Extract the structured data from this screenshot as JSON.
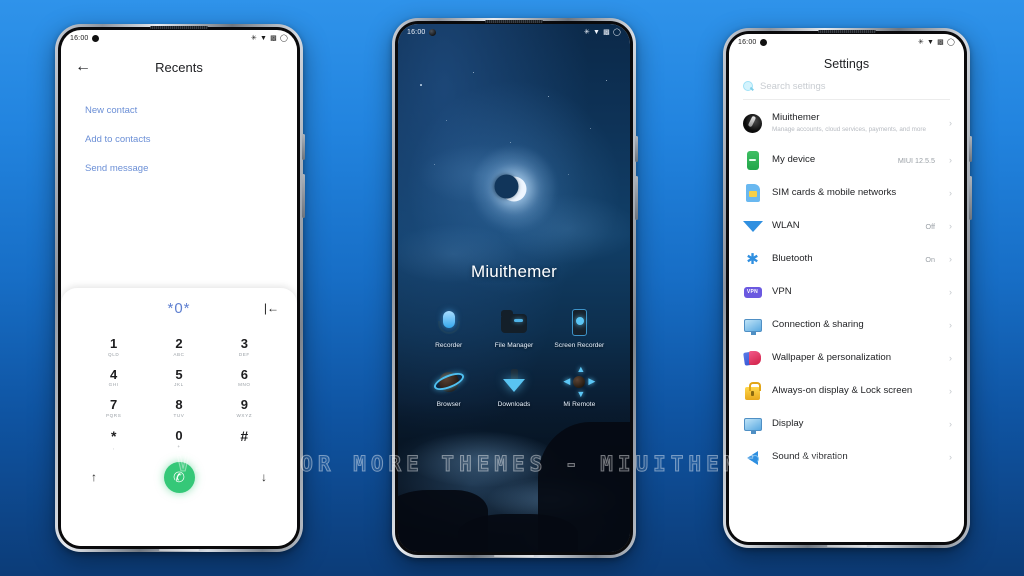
{
  "theme": {
    "background_top": "#2f93ea",
    "background_bottom": "#0c3c78",
    "accent_blue": "#6b8fd6",
    "call_green": "#35c878"
  },
  "watermark": "VISIT FOR MORE THEMES - MIUITHEMER.COM",
  "phone_dialer": {
    "status": {
      "time": "16:00"
    },
    "header": {
      "back_icon": "back-arrow-icon",
      "title": "Recents"
    },
    "actions": [
      {
        "label": "New contact"
      },
      {
        "label": "Add to contacts"
      },
      {
        "label": "Send message"
      }
    ],
    "dialpad": {
      "number": "*0*",
      "backspace_icon": "backspace-icon",
      "keys": [
        {
          "num": "1",
          "sub": "QLD"
        },
        {
          "num": "2",
          "sub": "ABC"
        },
        {
          "num": "3",
          "sub": "DEF"
        },
        {
          "num": "4",
          "sub": "GHI"
        },
        {
          "num": "5",
          "sub": "JKL"
        },
        {
          "num": "6",
          "sub": "MNO"
        },
        {
          "num": "7",
          "sub": "PQRS"
        },
        {
          "num": "8",
          "sub": "TUV"
        },
        {
          "num": "9",
          "sub": "WXYZ"
        },
        {
          "num": "*",
          "sub": ","
        },
        {
          "num": "0",
          "sub": "+"
        },
        {
          "num": "#",
          "sub": ""
        }
      ],
      "up_icon": "arrow-up-icon",
      "call_icon": "phone-call-icon",
      "down_icon": "arrow-down-icon"
    }
  },
  "phone_home": {
    "status": {
      "time": "16:00"
    },
    "title": "Miuithemer",
    "apps": [
      {
        "label": "Recorder",
        "icon": "microphone-icon"
      },
      {
        "label": "File Manager",
        "icon": "folder-icon"
      },
      {
        "label": "Screen Recorder",
        "icon": "screen-recorder-icon"
      },
      {
        "label": "Browser",
        "icon": "planet-browser-icon"
      },
      {
        "label": "Downloads",
        "icon": "download-arrow-icon"
      },
      {
        "label": "Mi Remote",
        "icon": "dpad-remote-icon"
      }
    ]
  },
  "phone_settings": {
    "status": {
      "time": "16:00"
    },
    "title": "Settings",
    "search": {
      "placeholder": "Search settings",
      "icon": "search-icon"
    },
    "items": [
      {
        "label": "Miuithemer",
        "desc": "Manage accounts, cloud services, payments, and more",
        "value": "",
        "icon": "account-avatar-icon"
      },
      {
        "label": "My device",
        "desc": "",
        "value": "MIUI 12.5.5",
        "icon": "device-icon"
      },
      {
        "label": "SIM cards & mobile networks",
        "desc": "",
        "value": "",
        "icon": "sim-card-icon"
      },
      {
        "label": "WLAN",
        "desc": "",
        "value": "Off",
        "icon": "wifi-icon"
      },
      {
        "label": "Bluetooth",
        "desc": "",
        "value": "On",
        "icon": "bluetooth-icon"
      },
      {
        "label": "VPN",
        "desc": "",
        "value": "",
        "icon": "vpn-icon"
      },
      {
        "label": "Connection & sharing",
        "desc": "",
        "value": "",
        "icon": "connection-sharing-icon"
      },
      {
        "label": "Wallpaper & personalization",
        "desc": "",
        "value": "",
        "icon": "wallpaper-icon"
      },
      {
        "label": "Always-on display & Lock screen",
        "desc": "",
        "value": "",
        "icon": "lock-icon"
      },
      {
        "label": "Display",
        "desc": "",
        "value": "",
        "icon": "display-icon"
      },
      {
        "label": "Sound & vibration",
        "desc": "",
        "value": "",
        "icon": "speaker-icon"
      }
    ]
  }
}
